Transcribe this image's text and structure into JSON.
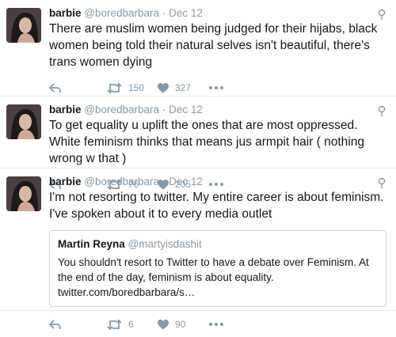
{
  "tweets": [
    {
      "name": "barbie",
      "handle": "@boredbarbara",
      "separator": "·",
      "date": "Dec 12",
      "text": "There are muslim women being judged for their hijabs, black women being told their natural selves isn't beautiful, there's trans women dying",
      "retweets": "150",
      "likes": "327"
    },
    {
      "name": "barbie",
      "handle": "@boredbarbara",
      "separator": "·",
      "date": "Dec 12",
      "text": "To get equality u uplift the ones that are most oppressed. White feminism thinks that means jus armpit hair ( nothing wrong w that )",
      "retweets": "76",
      "likes": "205"
    },
    {
      "name": "barbie",
      "handle": "@boredbarbara",
      "separator": "·",
      "date": "Dec 12",
      "text": "I'm not resorting to twitter. My entire career is about feminism. I've spoken about it to every media outlet",
      "quote": {
        "name": "Martin Reyna",
        "handle": "@martyisdashit",
        "text": "You shouldn't resort to Twitter to have a debate over Feminism. At the end of the day, feminism is about equality.  twitter.com/boredbarbara/s…"
      },
      "retweets": "6",
      "likes": "90"
    }
  ],
  "colors": {
    "text": "#14171a",
    "muted": "#8899a6",
    "border": "#e6ecf0"
  },
  "icons": [
    "avatar-photo",
    "pin-icon",
    "reply-icon",
    "retweet-icon",
    "like-heart-icon",
    "more-dots-icon"
  ]
}
